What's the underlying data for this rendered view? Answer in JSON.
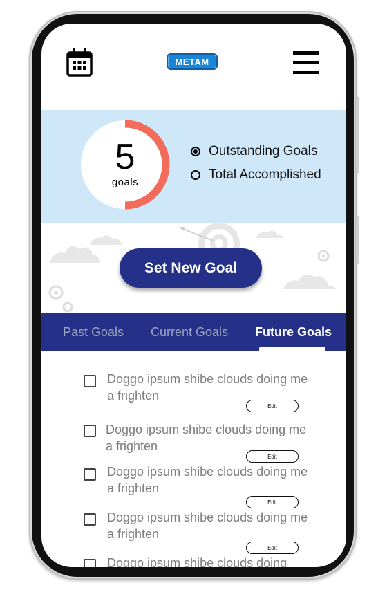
{
  "header": {
    "brand": "METAM",
    "calendar_icon": "calendar-icon",
    "menu_icon": "hamburger-menu-icon"
  },
  "stats": {
    "count": "5",
    "unit": "goals",
    "progress_fraction": 0.5,
    "legend": [
      {
        "label": "Outstanding Goals",
        "selected": true
      },
      {
        "label": "Total Accomplished",
        "selected": false
      }
    ],
    "ring_color": "#f26b5b"
  },
  "cta": {
    "label": "Set New Goal"
  },
  "tabs": [
    {
      "label": "Past Goals",
      "active": false
    },
    {
      "label": "Current Goals",
      "active": false
    },
    {
      "label": "Future Goals",
      "active": true
    }
  ],
  "goals": [
    {
      "text": "Doggo ipsum shibe clouds doing me a frighten",
      "edit": "Edit"
    },
    {
      "text": "Doggo ipsum shibe clouds doing me a frighten",
      "edit": "Edit"
    },
    {
      "text": "Doggo ipsum shibe clouds doing me a frighten",
      "edit": "Edit"
    },
    {
      "text": "Doggo ipsum shibe clouds doing me a frighten",
      "edit": "Edit"
    },
    {
      "text": "Doggo ipsum shibe clouds doing",
      "edit": ""
    }
  ],
  "colors": {
    "accent": "#253188",
    "band": "#cfe8f9",
    "brand": "#1b86d6"
  }
}
